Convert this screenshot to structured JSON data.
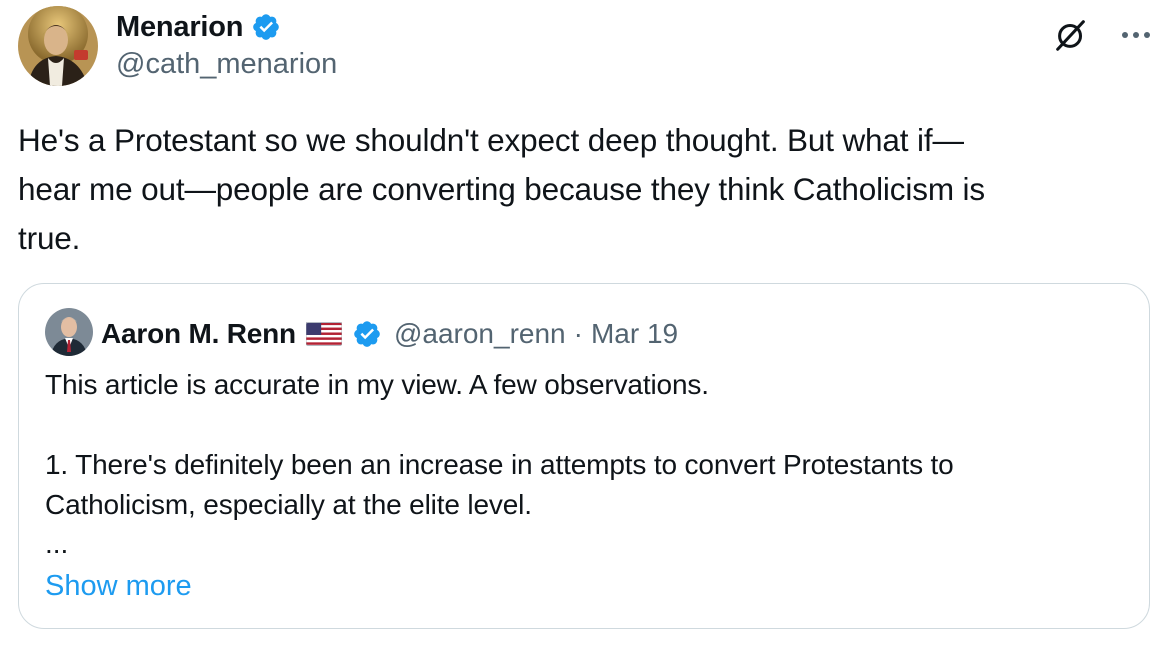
{
  "tweet": {
    "author": {
      "display_name": "Menarion",
      "handle": "@cath_menarion",
      "verified": true
    },
    "text": "He's a Protestant so we shouldn't expect deep thought. But what if—\nhear me out—people are converting because they think Catholicism is\ntrue.",
    "actions": {
      "grok_icon": "grok-icon",
      "more_icon": "more-icon"
    }
  },
  "quoted_tweet": {
    "author": {
      "display_name": "Aaron M. Renn",
      "flag": "🇺🇸",
      "handle": "@aaron_renn",
      "separator": "·",
      "date": "Mar 19",
      "verified": true
    },
    "text": "This article is accurate in my view. A few observations.\n\n1. There's definitely been an increase in attempts to convert Protestants to\nCatholicism, especially at the elite level.",
    "ellipsis": "...",
    "show_more_label": "Show more"
  },
  "colors": {
    "text": "#0f1419",
    "secondary": "#536471",
    "accent": "#1d9bf0",
    "border": "#cfd9de"
  }
}
